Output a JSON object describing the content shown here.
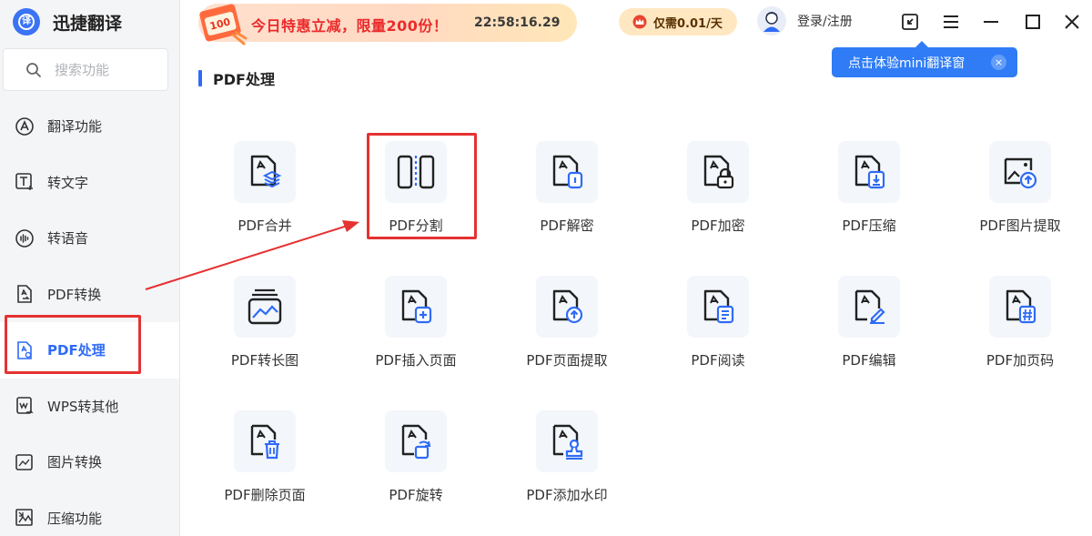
{
  "app": {
    "name": "迅捷翻译",
    "logo_glyph": "译"
  },
  "search": {
    "placeholder": "搜索功能"
  },
  "sidebar": {
    "items": [
      {
        "label": "翻译功能",
        "icon": "translate-icon"
      },
      {
        "label": "转文字",
        "icon": "text-convert-icon"
      },
      {
        "label": "转语音",
        "icon": "voice-icon"
      },
      {
        "label": "PDF转换",
        "icon": "pdf-convert-icon"
      },
      {
        "label": "PDF处理",
        "icon": "pdf-process-icon",
        "active": true
      },
      {
        "label": "WPS转其他",
        "icon": "wps-convert-icon"
      },
      {
        "label": "图片转换",
        "icon": "image-convert-icon"
      },
      {
        "label": "压缩功能",
        "icon": "compress-icon"
      }
    ]
  },
  "banner": {
    "badge": "100",
    "text": "今日特惠立减，限量200份！",
    "countdown": "22:58:16.29"
  },
  "vip": {
    "label": "仅需0.01/天"
  },
  "user": {
    "login_label": "登录/注册"
  },
  "tooltip": {
    "text": "点击体验mini翻译窗",
    "close": "×"
  },
  "section": {
    "title": "PDF处理"
  },
  "tools": [
    {
      "label": "PDF合并",
      "icon": "pdf-merge-icon"
    },
    {
      "label": "PDF分割",
      "icon": "pdf-split-icon",
      "highlighted": true
    },
    {
      "label": "PDF解密",
      "icon": "pdf-decrypt-icon"
    },
    {
      "label": "PDF加密",
      "icon": "pdf-encrypt-icon"
    },
    {
      "label": "PDF压缩",
      "icon": "pdf-compress-icon"
    },
    {
      "label": "PDF图片提取",
      "icon": "pdf-image-extract-icon"
    },
    {
      "label": "PDF转长图",
      "icon": "pdf-long-image-icon"
    },
    {
      "label": "PDF插入页面",
      "icon": "pdf-insert-page-icon"
    },
    {
      "label": "PDF页面提取",
      "icon": "pdf-page-extract-icon"
    },
    {
      "label": "PDF阅读",
      "icon": "pdf-read-icon"
    },
    {
      "label": "PDF编辑",
      "icon": "pdf-edit-icon"
    },
    {
      "label": "PDF加页码",
      "icon": "pdf-page-number-icon"
    },
    {
      "label": "PDF删除页面",
      "icon": "pdf-delete-page-icon"
    },
    {
      "label": "PDF旋转",
      "icon": "pdf-rotate-icon"
    },
    {
      "label": "PDF添加水印",
      "icon": "pdf-watermark-icon"
    }
  ],
  "colors": {
    "accent": "#2f6bf6",
    "highlight": "#e53232",
    "tile_bg": "#f3f6fb",
    "sidebar_bg": "#f4f5f7"
  }
}
